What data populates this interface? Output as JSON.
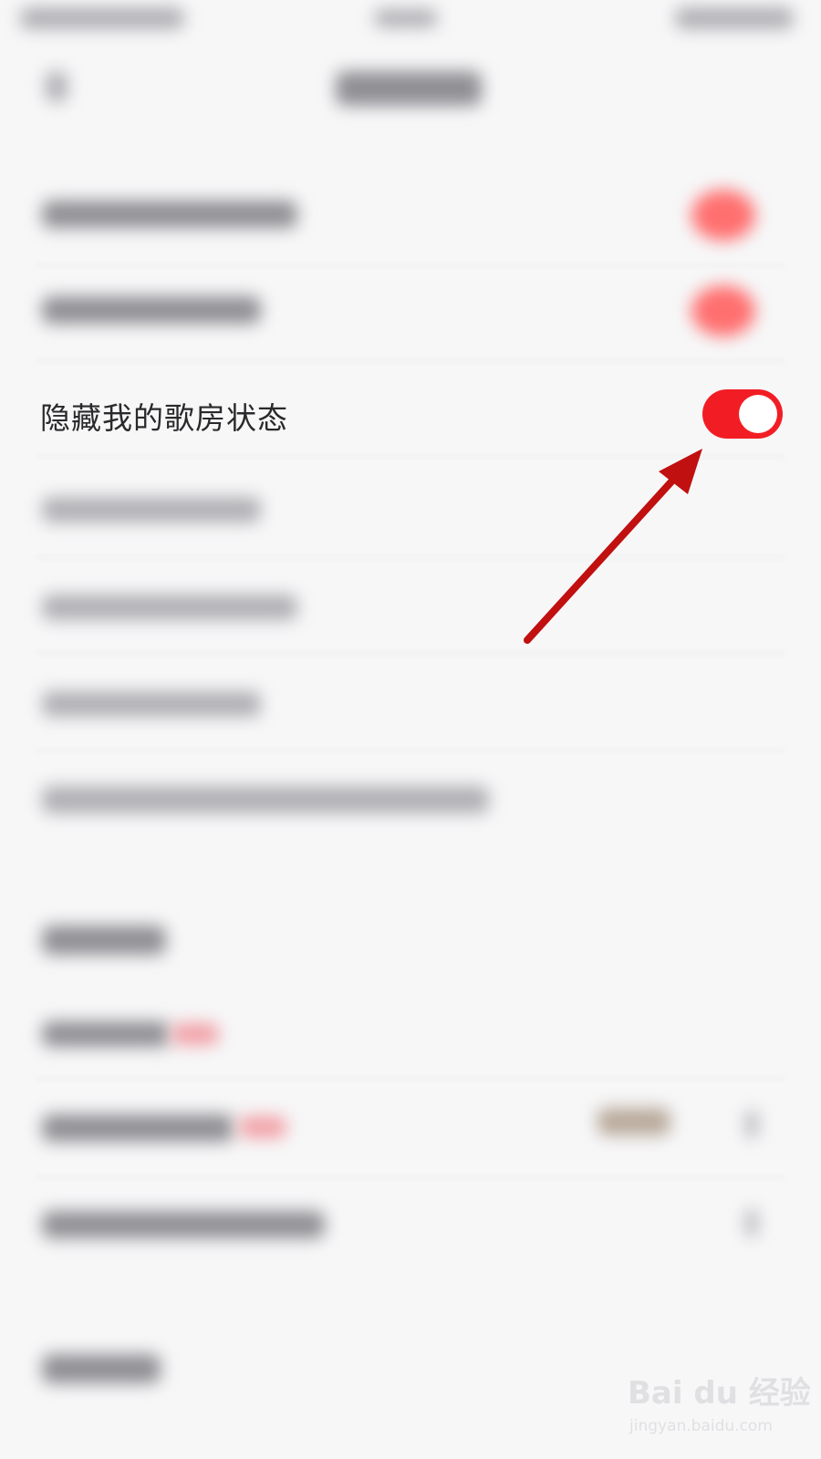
{
  "settings": {
    "hide_karaoke_status": {
      "label": "隐藏我的歌房状态",
      "enabled": true
    }
  },
  "colors": {
    "toggle_on": "#f21d24",
    "arrow": "#c0100f",
    "background": "#f7f7f8"
  },
  "watermark": {
    "logo": "Bai du 经验",
    "url": "jingyan.baidu.com"
  }
}
